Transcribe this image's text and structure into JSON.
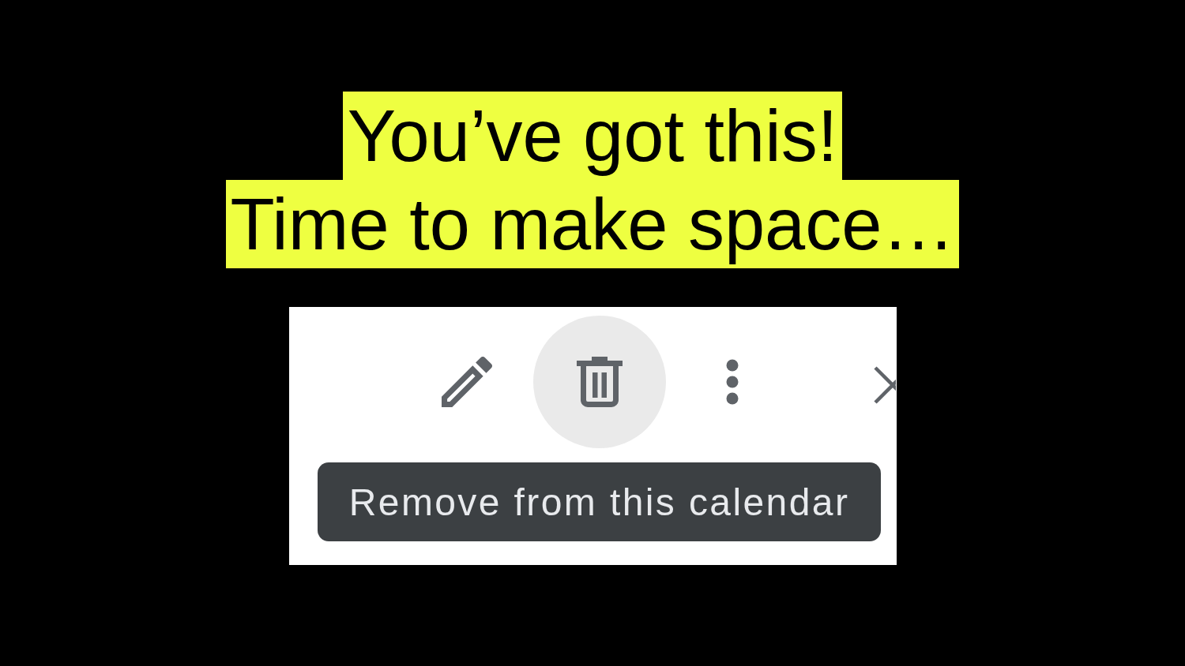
{
  "headline": {
    "lines": [
      "You’ve got this!",
      "Time to make space…"
    ]
  },
  "screenshot": {
    "toolbar": [
      {
        "kind": "edit",
        "hovered": false
      },
      {
        "kind": "delete",
        "hovered": true
      },
      {
        "kind": "more",
        "hovered": false
      },
      {
        "kind": "close",
        "hovered": false
      }
    ],
    "tooltip": "Remove from this calendar"
  }
}
